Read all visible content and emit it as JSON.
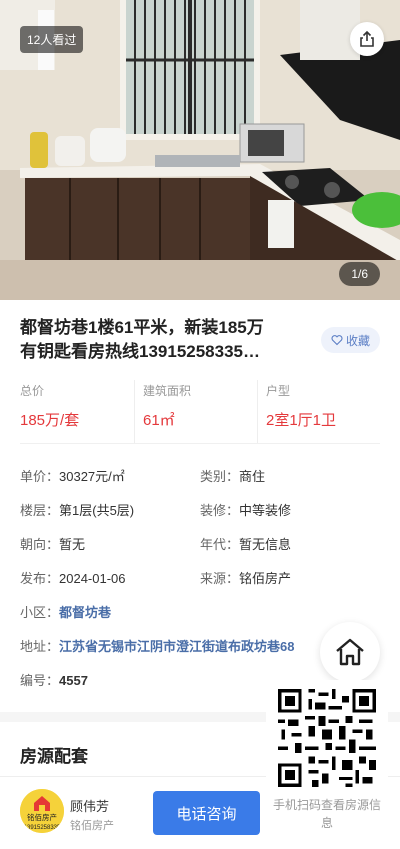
{
  "hero": {
    "views_badge": "12人看过",
    "page_counter": "1/6"
  },
  "listing": {
    "title_line1": "都督坊巷1楼61平米，新装185万",
    "title_line2": "有钥匙看房热线13915258335…",
    "favorite_label": "收藏"
  },
  "stats": [
    {
      "label": "总价",
      "value": "185万/套"
    },
    {
      "label": "建筑面积",
      "value": "61㎡"
    },
    {
      "label": "户型",
      "value": "2室1厅1卫"
    }
  ],
  "details": {
    "unit_price_label": "单价：",
    "unit_price": "30327元/㎡",
    "type_label": "类别：",
    "type": "商住",
    "floor_label": "楼层：",
    "floor": "第1层(共5层)",
    "decoration_label": "装修：",
    "decoration": "中等装修",
    "orientation_label": "朝向：",
    "orientation": "暂无",
    "year_label": "年代：",
    "year": "暂无信息",
    "publish_label": "发布：",
    "publish": "2024-01-06",
    "source_label": "来源：",
    "source": "铭佰房产",
    "community_label": "小区：",
    "community": "都督坊巷",
    "address_label": "地址：",
    "address": "江苏省无锡市江阴市澄江街道布政坊巷68",
    "id_label": "编号：",
    "id": "4557"
  },
  "section": {
    "title": "房源配套"
  },
  "agent": {
    "name": "顾伟芳",
    "company": "铭佰房产",
    "avatar_text": "铭佰房产",
    "avatar_phone": "13915258335",
    "call_label": "电话咨询"
  },
  "qr": {
    "caption": "手机扫码查看房源信息"
  },
  "colors": {
    "accent_red": "#e4393c",
    "link_blue": "#4a6ea8",
    "button_blue": "#3a7be8"
  }
}
